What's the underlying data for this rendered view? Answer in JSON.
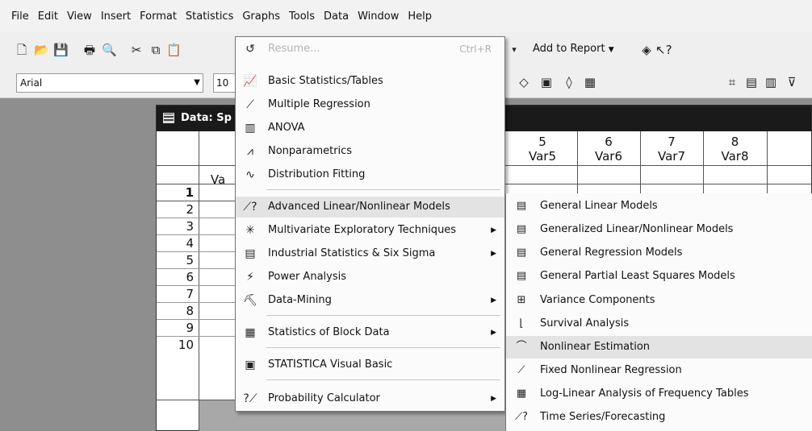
{
  "menubar": {
    "items": [
      "File",
      "Edit",
      "View",
      "Insert",
      "Format",
      "Statistics",
      "Graphs",
      "Tools",
      "Data",
      "Window",
      "Help"
    ]
  },
  "toolbar": {
    "add_to_report": "Add to Report",
    "font_name": "Arial",
    "font_size": "10"
  },
  "datawin": {
    "title": "Data: Sp",
    "columns": [
      {
        "num": "5",
        "name": "Var5"
      },
      {
        "num": "6",
        "name": "Var6"
      },
      {
        "num": "7",
        "name": "Var7"
      },
      {
        "num": "8",
        "name": "Var8"
      }
    ],
    "partial_col_name": "Va",
    "rows": [
      "1",
      "2",
      "3",
      "4",
      "5",
      "6",
      "7",
      "8",
      "9",
      "10"
    ]
  },
  "statistics_menu": {
    "resume": {
      "label": "Resume...",
      "shortcut": "Ctrl+R"
    },
    "items": [
      {
        "label": "Basic Statistics/Tables",
        "icon": "basic-stats-icon"
      },
      {
        "label": "Multiple Regression",
        "icon": "regression-icon"
      },
      {
        "label": "ANOVA",
        "icon": "anova-icon"
      },
      {
        "label": "Nonparametrics",
        "icon": "nonparametrics-icon"
      },
      {
        "label": "Distribution Fitting",
        "icon": "distribution-icon"
      },
      {
        "label": "Advanced Linear/Nonlinear Models",
        "icon": "advanced-models-icon"
      },
      {
        "label": "Multivariate Exploratory Techniques",
        "icon": "multivariate-icon"
      },
      {
        "label": "Industrial Statistics & Six Sigma",
        "icon": "industrial-icon"
      },
      {
        "label": "Power Analysis",
        "icon": "power-icon"
      },
      {
        "label": "Data-Mining",
        "icon": "data-mining-icon"
      },
      {
        "label": "Statistics of Block Data",
        "icon": "block-data-icon"
      },
      {
        "label": "STATISTICA Visual Basic",
        "icon": "visual-basic-icon"
      },
      {
        "label": "Probability Calculator",
        "icon": "probability-icon"
      }
    ]
  },
  "submenu": {
    "items": [
      {
        "label": "General Linear Models",
        "icon": "glm-icon"
      },
      {
        "label": "Generalized Linear/Nonlinear Models",
        "icon": "glz-icon"
      },
      {
        "label": "General Regression Models",
        "icon": "grm-icon"
      },
      {
        "label": "General Partial Least Squares Models",
        "icon": "pls-icon"
      },
      {
        "label": "Variance Components",
        "icon": "variance-icon"
      },
      {
        "label": "Survival Analysis",
        "icon": "survival-icon"
      },
      {
        "label": "Nonlinear Estimation",
        "icon": "nonlinear-icon"
      },
      {
        "label": "Fixed Nonlinear Regression",
        "icon": "fixed-nonlinear-icon"
      },
      {
        "label": "Log-Linear Analysis of Frequency Tables",
        "icon": "log-linear-icon"
      },
      {
        "label": "Time Series/Forecasting",
        "icon": "time-series-icon"
      }
    ]
  }
}
